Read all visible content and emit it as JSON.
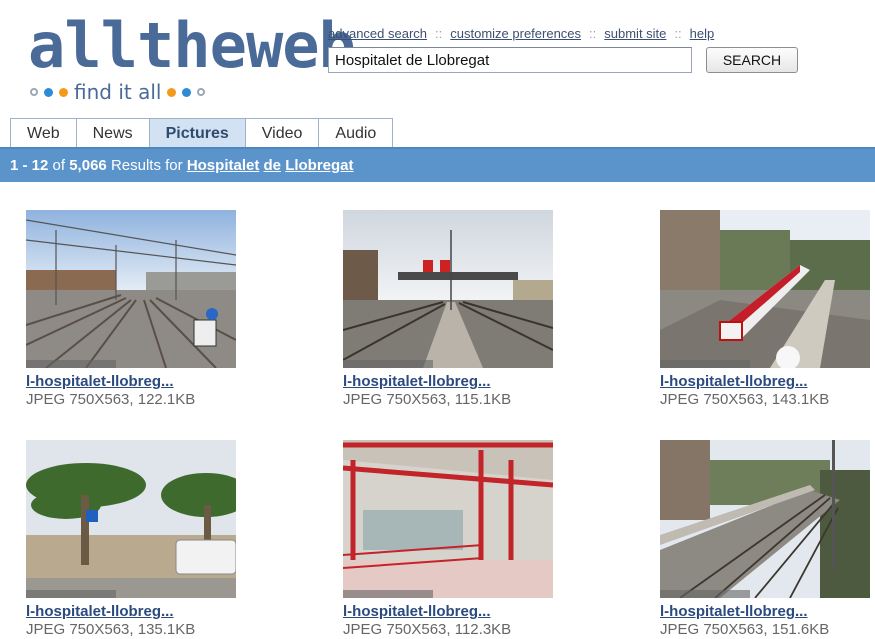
{
  "logo": {
    "wordmark": "alltheweb",
    "tagline": "find it all"
  },
  "toplinks": [
    {
      "label": "advanced search"
    },
    {
      "label": "customize preferences"
    },
    {
      "label": "submit site"
    },
    {
      "label": "help"
    }
  ],
  "search": {
    "value": "Hospitalet de Llobregat",
    "button_label": "SEARCH"
  },
  "tabs": [
    {
      "label": "Web",
      "active": false
    },
    {
      "label": "News",
      "active": false
    },
    {
      "label": "Pictures",
      "active": true
    },
    {
      "label": "Video",
      "active": false
    },
    {
      "label": "Audio",
      "active": false
    }
  ],
  "results_bar": {
    "range": "1 - 12",
    "of_text": "of",
    "total": "5,066",
    "results_for_text": "Results for",
    "query_terms": [
      "Hospitalet",
      "de",
      "Llobregat"
    ]
  },
  "results": [
    {
      "title": "l-hospitalet-llobreg...",
      "meta": "JPEG 750X563, 122.1KB",
      "image": "railway-tracks-station-photo"
    },
    {
      "title": "l-hospitalet-llobreg...",
      "meta": "JPEG 750X563, 115.1KB",
      "image": "station-platform-signal-photo"
    },
    {
      "title": "l-hospitalet-llobreg...",
      "meta": "JPEG 750X563, 143.1KB",
      "image": "red-white-train-photo"
    },
    {
      "title": "l-hospitalet-llobreg...",
      "meta": "JPEG 750X563, 135.1KB",
      "image": "palm-trees-street-photo"
    },
    {
      "title": "l-hospitalet-llobreg...",
      "meta": "JPEG 750X563, 112.3KB",
      "image": "red-canopy-station-photo"
    },
    {
      "title": "l-hospitalet-llobreg...",
      "meta": "JPEG 750X563, 151.6KB",
      "image": "elevated-tracks-photo"
    }
  ],
  "colors": {
    "brand_blue": "#4a6a98",
    "bar_blue": "#5b93cb",
    "link_blue": "#2b4a7e"
  }
}
